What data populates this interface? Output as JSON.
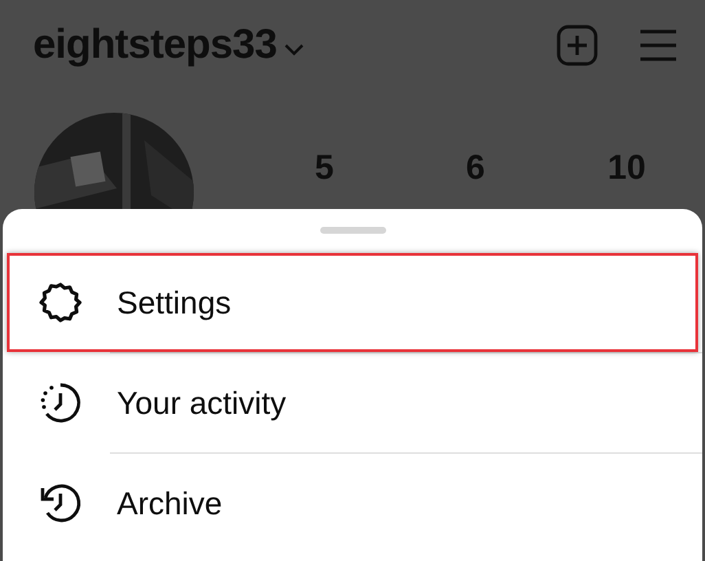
{
  "header": {
    "username": "eightsteps33"
  },
  "profile": {
    "stats": [
      {
        "count": "5"
      },
      {
        "count": "6"
      },
      {
        "count": "10"
      }
    ]
  },
  "menu_sheet": {
    "items": [
      {
        "label": "Settings",
        "kind": "gear",
        "highlighted": true
      },
      {
        "label": "Your activity",
        "kind": "activity",
        "highlighted": false
      },
      {
        "label": "Archive",
        "kind": "archive",
        "highlighted": false
      }
    ]
  }
}
